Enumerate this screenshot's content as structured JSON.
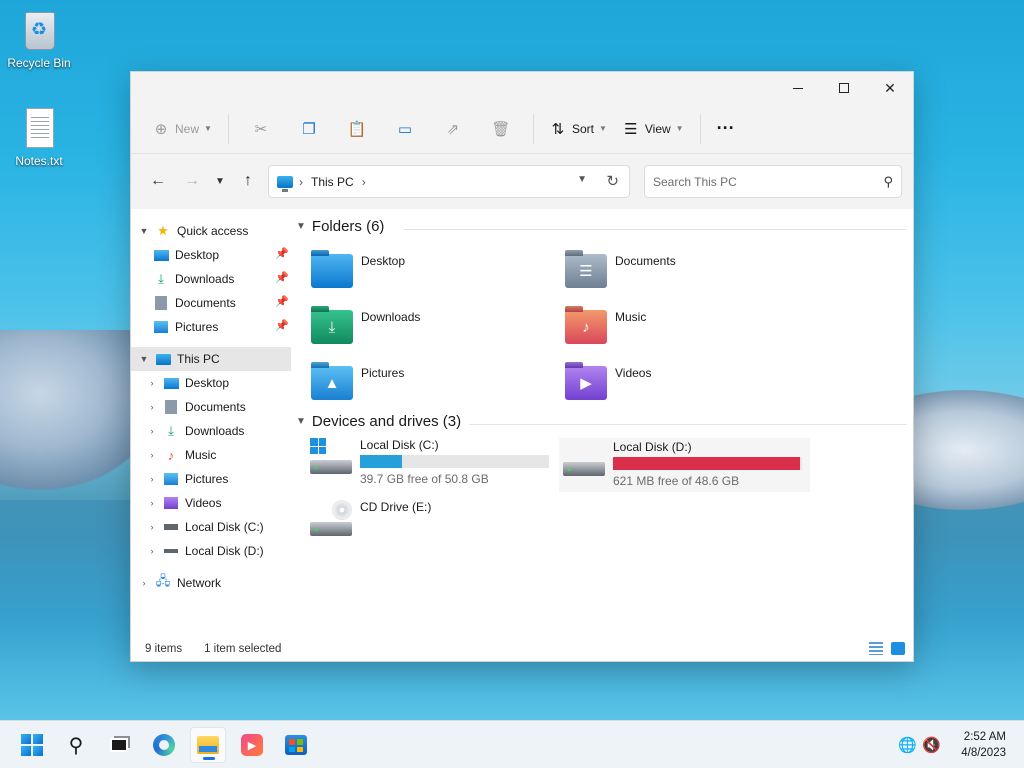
{
  "desktop": {
    "icons": [
      {
        "label": "Recycle Bin",
        "icon": "recycle-bin-icon"
      },
      {
        "label": "Notes.txt",
        "icon": "text-file-icon"
      }
    ]
  },
  "window": {
    "command_bar": {
      "new_label": "New",
      "sort_label": "Sort",
      "view_label": "View",
      "more_label": "···"
    },
    "address": {
      "crumbs": [
        "This PC"
      ],
      "search_placeholder": "Search This PC"
    },
    "nav_pane": {
      "quick_access": {
        "label": "Quick access",
        "items": [
          "Desktop",
          "Downloads",
          "Documents",
          "Pictures"
        ]
      },
      "this_pc": {
        "label": "This PC",
        "items": [
          "Desktop",
          "Documents",
          "Downloads",
          "Music",
          "Pictures",
          "Videos",
          "Local Disk (C:)",
          "Local Disk (D:)"
        ]
      },
      "network": {
        "label": "Network"
      }
    },
    "content": {
      "folders_header": "Folders (6)",
      "folders": [
        "Desktop",
        "Documents",
        "Downloads",
        "Music",
        "Pictures",
        "Videos"
      ],
      "drives_header": "Devices and drives (3)",
      "drives": [
        {
          "name": "Local Disk (C:)",
          "free": "39.7 GB free of 50.8 GB",
          "used_fraction": 0.22,
          "bar_color": "#26a0da"
        },
        {
          "name": "Local Disk (D:)",
          "free": "621 MB free of 48.6 GB",
          "used_fraction": 0.99,
          "bar_color": "#da2f4a"
        },
        {
          "name": "CD Drive (E:)"
        }
      ]
    },
    "status": {
      "count": "9 items",
      "selection": "1 item selected"
    }
  },
  "taskbar": {
    "time": "2:52 AM",
    "date": "4/8/2023"
  },
  "colors": {
    "accent": "#1a73d9",
    "drive_ok": "#26a0da",
    "drive_full": "#da2f4a"
  }
}
